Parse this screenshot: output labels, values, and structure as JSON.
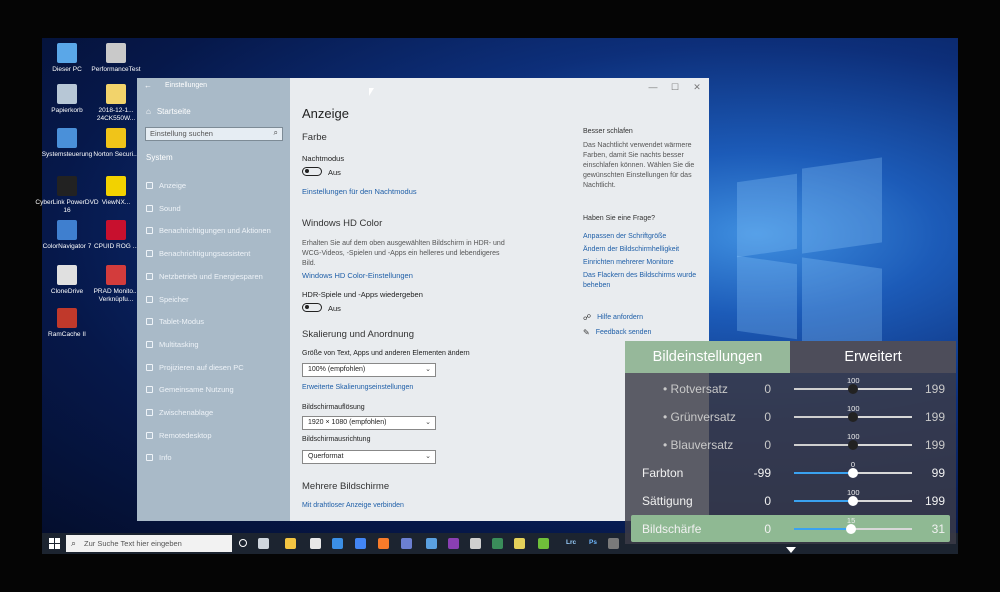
{
  "desktop_icons": [
    {
      "label": "Dieser PC",
      "icon": "pc-icon",
      "color": "#5aa7e8"
    },
    {
      "label": "PerformanceTest",
      "icon": "performancetest-icon",
      "color": "#c9c9c9"
    },
    {
      "label": "Papierkorb",
      "icon": "recycle-bin-icon",
      "color": "#b7c7d6"
    },
    {
      "label": "2018-12-1... 24CK550W...",
      "icon": "file-icon",
      "color": "#f2d36b"
    },
    {
      "label": "Systemsteuerung",
      "icon": "control-panel-icon",
      "color": "#4a90d9"
    },
    {
      "label": "Norton Securi...",
      "icon": "norton-icon",
      "color": "#f0c419"
    },
    {
      "label": "CyberLink PowerDVD 16",
      "icon": "powerdvd-icon",
      "color": "#222222"
    },
    {
      "label": "ViewNX...",
      "icon": "viewnx-icon",
      "color": "#f2d200"
    },
    {
      "label": "ColorNavigator 7",
      "icon": "colornavigator-icon",
      "color": "#3f7fcf"
    },
    {
      "label": "CPUID ROG ...",
      "icon": "cpuid-icon",
      "color": "#c8102e"
    },
    {
      "label": "CloneDrive",
      "icon": "clonedrive-icon",
      "color": "#e0e0e0"
    },
    {
      "label": "PRAD Monito... Verknüpfu...",
      "icon": "prad-icon",
      "color": "#d33c3c"
    },
    {
      "label": "RamCache II",
      "icon": "ramcache-icon",
      "color": "#c0392b"
    }
  ],
  "settings": {
    "window_title": "Einstellungen",
    "back_label": "←",
    "controls": {
      "minimize": "—",
      "maximize": "☐",
      "close": "✕"
    },
    "sidebar": {
      "home": "Startseite",
      "search_placeholder": "Einstellung suchen",
      "section": "System",
      "items": [
        {
          "label": "Anzeige",
          "icon": "display-icon"
        },
        {
          "label": "Sound",
          "icon": "sound-icon"
        },
        {
          "label": "Benachrichtigungen und Aktionen",
          "icon": "notifications-icon"
        },
        {
          "label": "Benachrichtigungsassistent",
          "icon": "focus-assist-icon"
        },
        {
          "label": "Netzbetrieb und Energiesparen",
          "icon": "power-icon"
        },
        {
          "label": "Speicher",
          "icon": "storage-icon"
        },
        {
          "label": "Tablet-Modus",
          "icon": "tablet-icon"
        },
        {
          "label": "Multitasking",
          "icon": "multitasking-icon"
        },
        {
          "label": "Projizieren auf diesen PC",
          "icon": "project-icon"
        },
        {
          "label": "Gemeinsame Nutzung",
          "icon": "shared-icon"
        },
        {
          "label": "Zwischenablage",
          "icon": "clipboard-icon"
        },
        {
          "label": "Remotedesktop",
          "icon": "remote-desktop-icon"
        },
        {
          "label": "Info",
          "icon": "info-icon"
        }
      ]
    },
    "main": {
      "page_title": "Anzeige",
      "color_heading": "Farbe",
      "nightmode_label": "Nachtmodus",
      "nightmode_state": "Aus",
      "nightmode_link": "Einstellungen für den Nachtmodus",
      "hdr_heading": "Windows HD Color",
      "hdr_desc_1": "Erhalten Sie auf dem oben ausgewählten Bildschirm in HDR- und",
      "hdr_desc_2": "WCG-Videos, -Spielen und -Apps ein helleres und lebendigeres",
      "hdr_desc_3": "Bild.",
      "hdr_link": "Windows HD Color-Einstellungen",
      "hdr_games_label": "HDR-Spiele und -Apps wiedergeben",
      "hdr_games_state": "Aus",
      "scale_heading": "Skalierung und Anordnung",
      "scale_label": "Größe von Text, Apps und anderen Elementen ändern",
      "scale_value": "100% (empfohlen)",
      "scale_link": "Erweiterte Skalierungseinstellungen",
      "resolution_label": "Bildschirmauflösung",
      "resolution_value": "1920 × 1080 (empfohlen)",
      "orientation_label": "Bildschirmausrichtung",
      "orientation_value": "Querformat",
      "multi_heading": "Mehrere Bildschirme",
      "multi_link": "Mit drahtloser Anzeige verbinden"
    },
    "aside": {
      "sleep_heading": "Besser schlafen",
      "sleep_text_1": "Das Nachtlicht verwendet wärmere",
      "sleep_text_2": "Farben, damit Sie nachts besser",
      "sleep_text_3": "einschlafen können. Wählen Sie die",
      "sleep_text_4": "gewünschten Einstellungen für das",
      "sleep_text_5": "Nachtlicht.",
      "question_heading": "Haben Sie eine Frage?",
      "links": [
        "Anpassen der Schriftgröße",
        "Ändern der Bildschirmhelligkeit",
        "Einrichten mehrerer Monitore",
        "Das Flackern des Bildschirms wurde",
        "beheben"
      ],
      "help_link": "Hilfe anfordern",
      "feedback_link": "Feedback senden"
    }
  },
  "taskbar": {
    "search_placeholder": "Zur Suche Text hier eingeben",
    "apps": [
      {
        "icon": "task-view-icon",
        "color": "#cfd6de"
      },
      {
        "icon": "file-explorer-icon",
        "color": "#f4c542"
      },
      {
        "icon": "app-icon",
        "color": "#e8e8e8"
      },
      {
        "icon": "edge-icon",
        "color": "#3b8fe6"
      },
      {
        "icon": "chrome-icon",
        "color": "#4285f4"
      },
      {
        "icon": "firefox-icon",
        "color": "#f77b2a"
      },
      {
        "icon": "app-icon-2",
        "color": "#6b7fd1"
      },
      {
        "icon": "app-icon-3",
        "color": "#5aa0e0"
      },
      {
        "icon": "onenote-icon",
        "color": "#8a3fb3"
      },
      {
        "icon": "app-icon-4",
        "color": "#cfcfcf"
      },
      {
        "icon": "app-icon-5",
        "color": "#3a8d5a"
      },
      {
        "icon": "app-icon-6",
        "color": "#e4d15a"
      },
      {
        "icon": "app-icon-7",
        "color": "#6fc03a"
      },
      {
        "icon": "lightroom-icon",
        "color": "#1d3d5e"
      },
      {
        "icon": "photoshop-icon",
        "color": "#1f3c6a"
      },
      {
        "icon": "app-icon-8",
        "color": "#7a7a7a"
      }
    ],
    "lr_label": "Lrc",
    "ps_label": "Ps"
  },
  "osd": {
    "tab_active": "Bildeinstellungen",
    "tab_inactive": "Erweitert",
    "accent": "#8fb993",
    "rows": [
      {
        "label": "• Rotversatz",
        "value": "0",
        "max": "199",
        "knob": "100",
        "position": 100,
        "min": 0,
        "range_max": 199,
        "dim": true,
        "selected": false
      },
      {
        "label": "• Grünversatz",
        "value": "0",
        "max": "199",
        "knob": "100",
        "position": 100,
        "min": 0,
        "range_max": 199,
        "dim": true,
        "selected": false
      },
      {
        "label": "• Blauversatz",
        "value": "0",
        "max": "199",
        "knob": "100",
        "position": 100,
        "min": 0,
        "range_max": 199,
        "dim": true,
        "selected": false
      },
      {
        "label": "Farbton",
        "value": "-99",
        "max": "99",
        "knob": "0",
        "position": 0,
        "min": -99,
        "range_max": 99,
        "dim": false,
        "selected": false
      },
      {
        "label": "Sättigung",
        "value": "0",
        "max": "199",
        "knob": "100",
        "position": 100,
        "min": 0,
        "range_max": 199,
        "dim": false,
        "selected": false
      },
      {
        "label": "Bildschärfe",
        "value": "0",
        "max": "31",
        "knob": "15",
        "position": 15,
        "min": 0,
        "range_max": 31,
        "dim": false,
        "selected": true
      }
    ]
  }
}
